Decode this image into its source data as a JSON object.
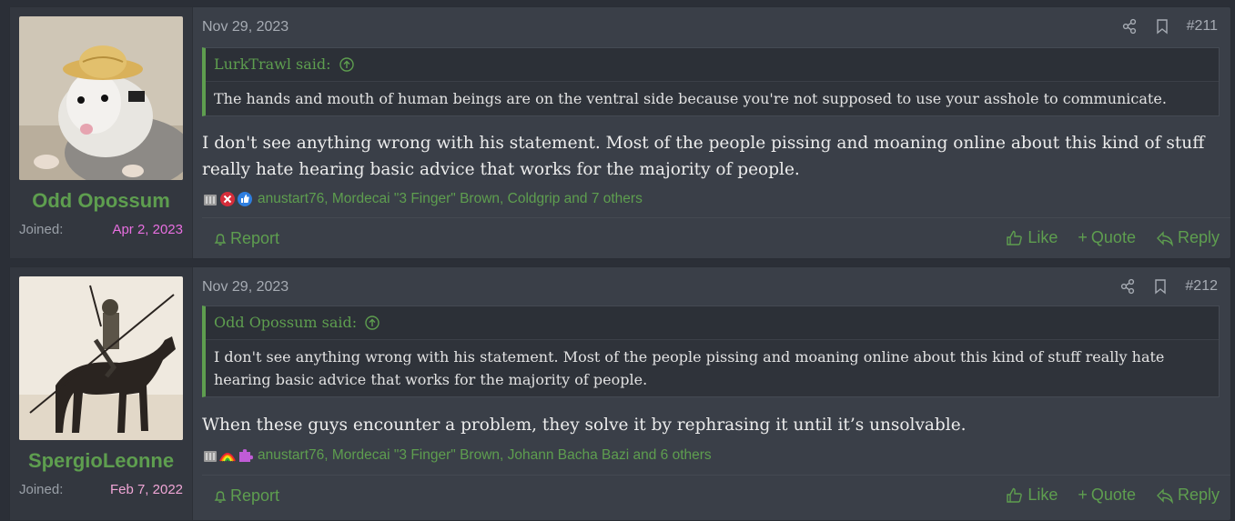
{
  "posts": [
    {
      "username": "Odd Opossum",
      "joined_label": "Joined:",
      "joined_date": "Apr 2, 2023",
      "joined_color": "#e86fe0",
      "date": "Nov 29, 2023",
      "number": "#211",
      "quote_author": "LurkTrawl said:",
      "quote_text": "The hands and mouth of human beings are on the ventral side because you're not supposed to use your asshole to communicate.",
      "message": "I don't see anything wrong with his statement. Most of the people pissing and moaning online about this kind of stuff really hate hearing basic advice that works for the majority of people.",
      "reactions_text": "anustart76, Mordecai \"3 Finger\" Brown, Coldgrip and 7 others",
      "report": "Report",
      "like": "Like",
      "quote_btn": "Quote",
      "reply": "Reply"
    },
    {
      "username": "SpergioLeonne",
      "joined_label": "Joined:",
      "joined_date": "Feb 7, 2022",
      "joined_color": "#f0a6d6",
      "date": "Nov 29, 2023",
      "number": "#212",
      "quote_author": "Odd Opossum said:",
      "quote_text": "I don't see anything wrong with his statement. Most of the people pissing and moaning online about this kind of stuff really hate hearing basic advice that works for the majority of people.",
      "message": "When these guys encounter a problem, they solve it by rephrasing it until it’s unsolvable.",
      "reactions_text": "anustart76, Mordecai \"3 Finger\" Brown, Johann Bacha Bazi and 6 others",
      "report": "Report",
      "like": "Like",
      "quote_btn": "Quote",
      "reply": "Reply"
    }
  ],
  "colors": {
    "accent": "#5e9e4f",
    "background": "#2b2f37",
    "post_background": "#3a3f48"
  }
}
